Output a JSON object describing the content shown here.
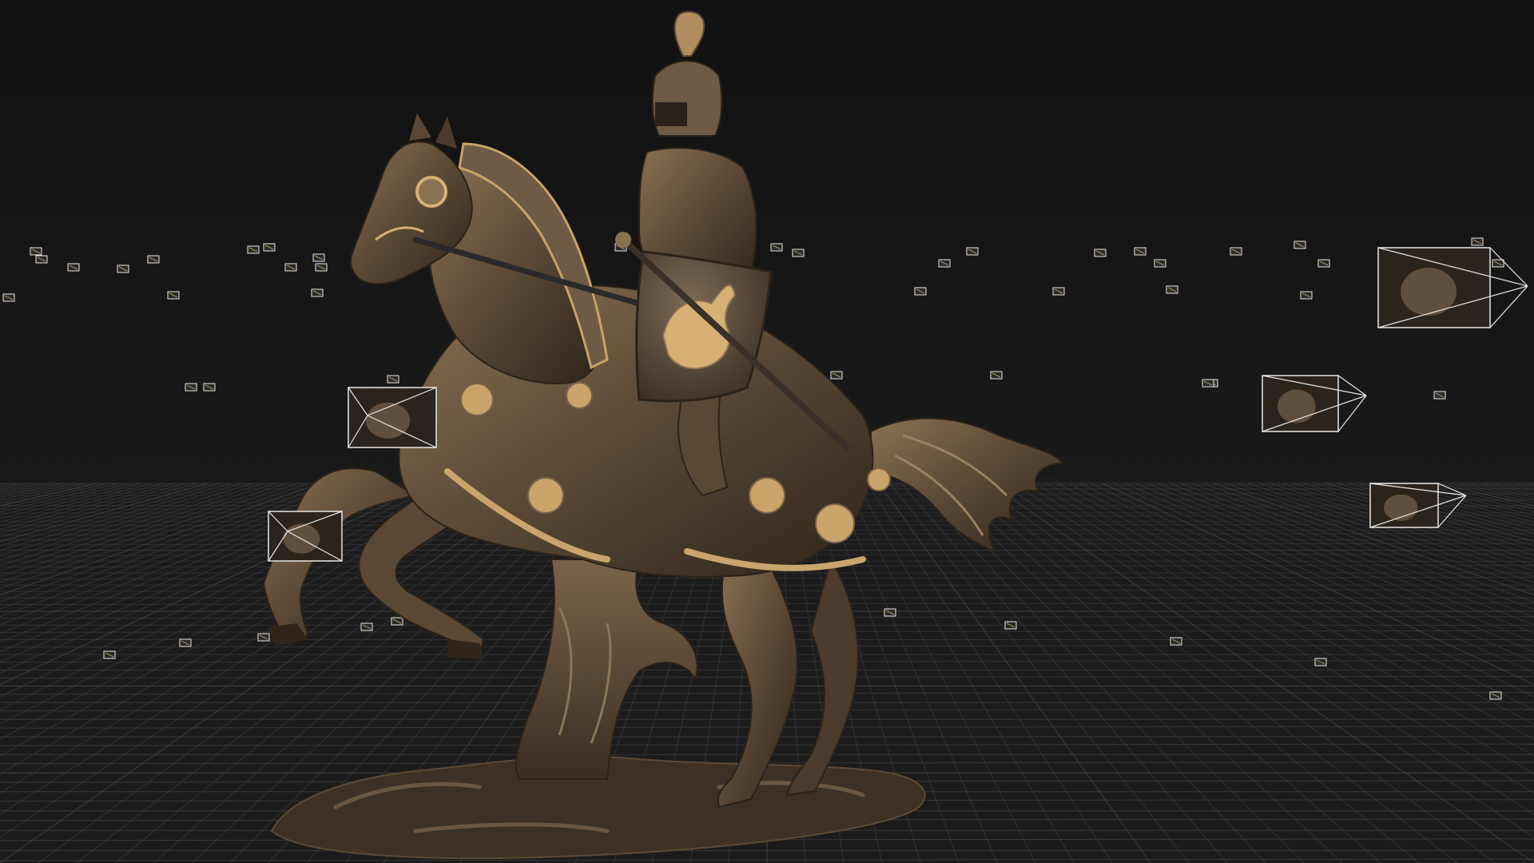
{
  "viewport": {
    "background_color": "#141414",
    "floor_color": "#1b1b1b",
    "grid_color": "#3c3c3c",
    "grid_major_color": "#4a4a4a",
    "camera_frustum_color": "#e8e8e8",
    "model_bronze_dark": "#3a2e22",
    "model_bronze_mid": "#6e5a45",
    "model_bronze_light": "#b08d5e",
    "model_gold_accent": "#d6b074"
  },
  "scene": {
    "subject": "knight-on-horse-statue-model",
    "grid_visible": true,
    "camera_markers_shown": true,
    "large_camera_frustums_shown": true
  },
  "icons": {
    "camera_marker": "camera-frustum-icon",
    "camera_preview": "camera-preview-thumbnail-icon"
  }
}
